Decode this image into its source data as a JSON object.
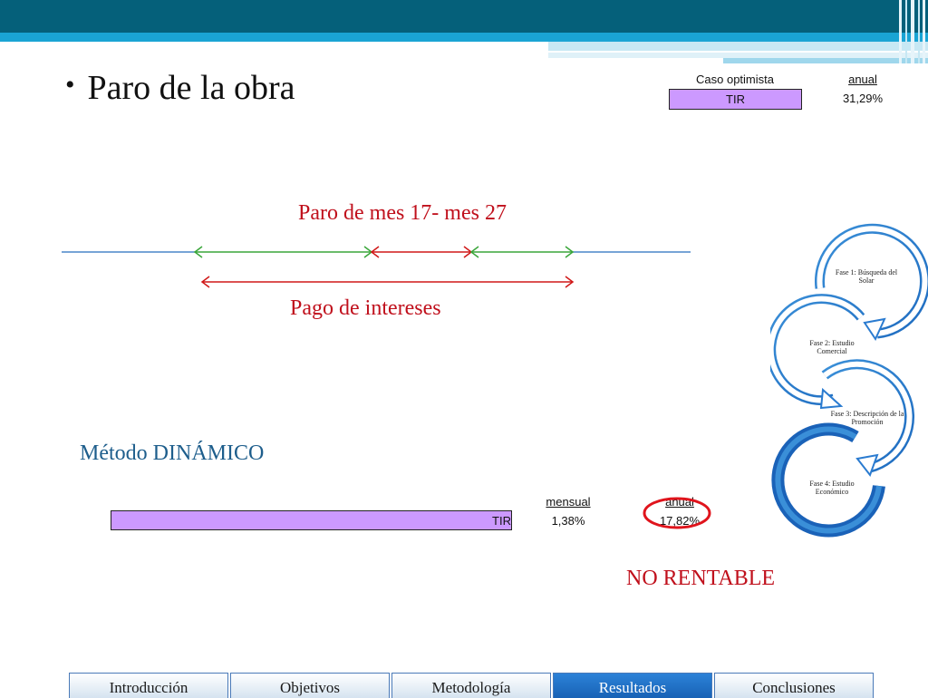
{
  "slide": {
    "title": "Paro de la obra",
    "bullet": "•"
  },
  "top_table": {
    "case_label": "Caso optimista",
    "period_label": "anual",
    "row_label": "TIR",
    "row_value": "31,29%"
  },
  "timeline": {
    "paro_label": "Paro de mes  17- mes 27",
    "pago_label": "Pago de intereses"
  },
  "dynamic": {
    "method_label": "Método DINÁMICO",
    "mensual_label": "mensual",
    "anual_label": "anual",
    "row_label": "TIR",
    "mensual_value": "1,38%",
    "anual_value": "17,82%",
    "verdict": "NO RENTABLE"
  },
  "cycle": {
    "phases": [
      "Fase 1: Búsqueda del  Solar",
      "Fase 2: Estudio Comercial",
      "Fase 3: Descripción de la     Promoción",
      "Fase 4: Estudio Económico"
    ]
  },
  "nav": {
    "tabs": [
      {
        "label": "Introducción"
      },
      {
        "label": "Objetivos"
      },
      {
        "label": "Metodología"
      },
      {
        "label": "Resultados"
      },
      {
        "label": "Conclusiones"
      }
    ],
    "active_index": 3
  },
  "colors": {
    "header_dark": "#05607a",
    "header_accent": "#1aa4d4",
    "highlight_red": "#c0101c",
    "cell_purple": "#cc99ff",
    "method_blue": "#1e5e8c"
  }
}
